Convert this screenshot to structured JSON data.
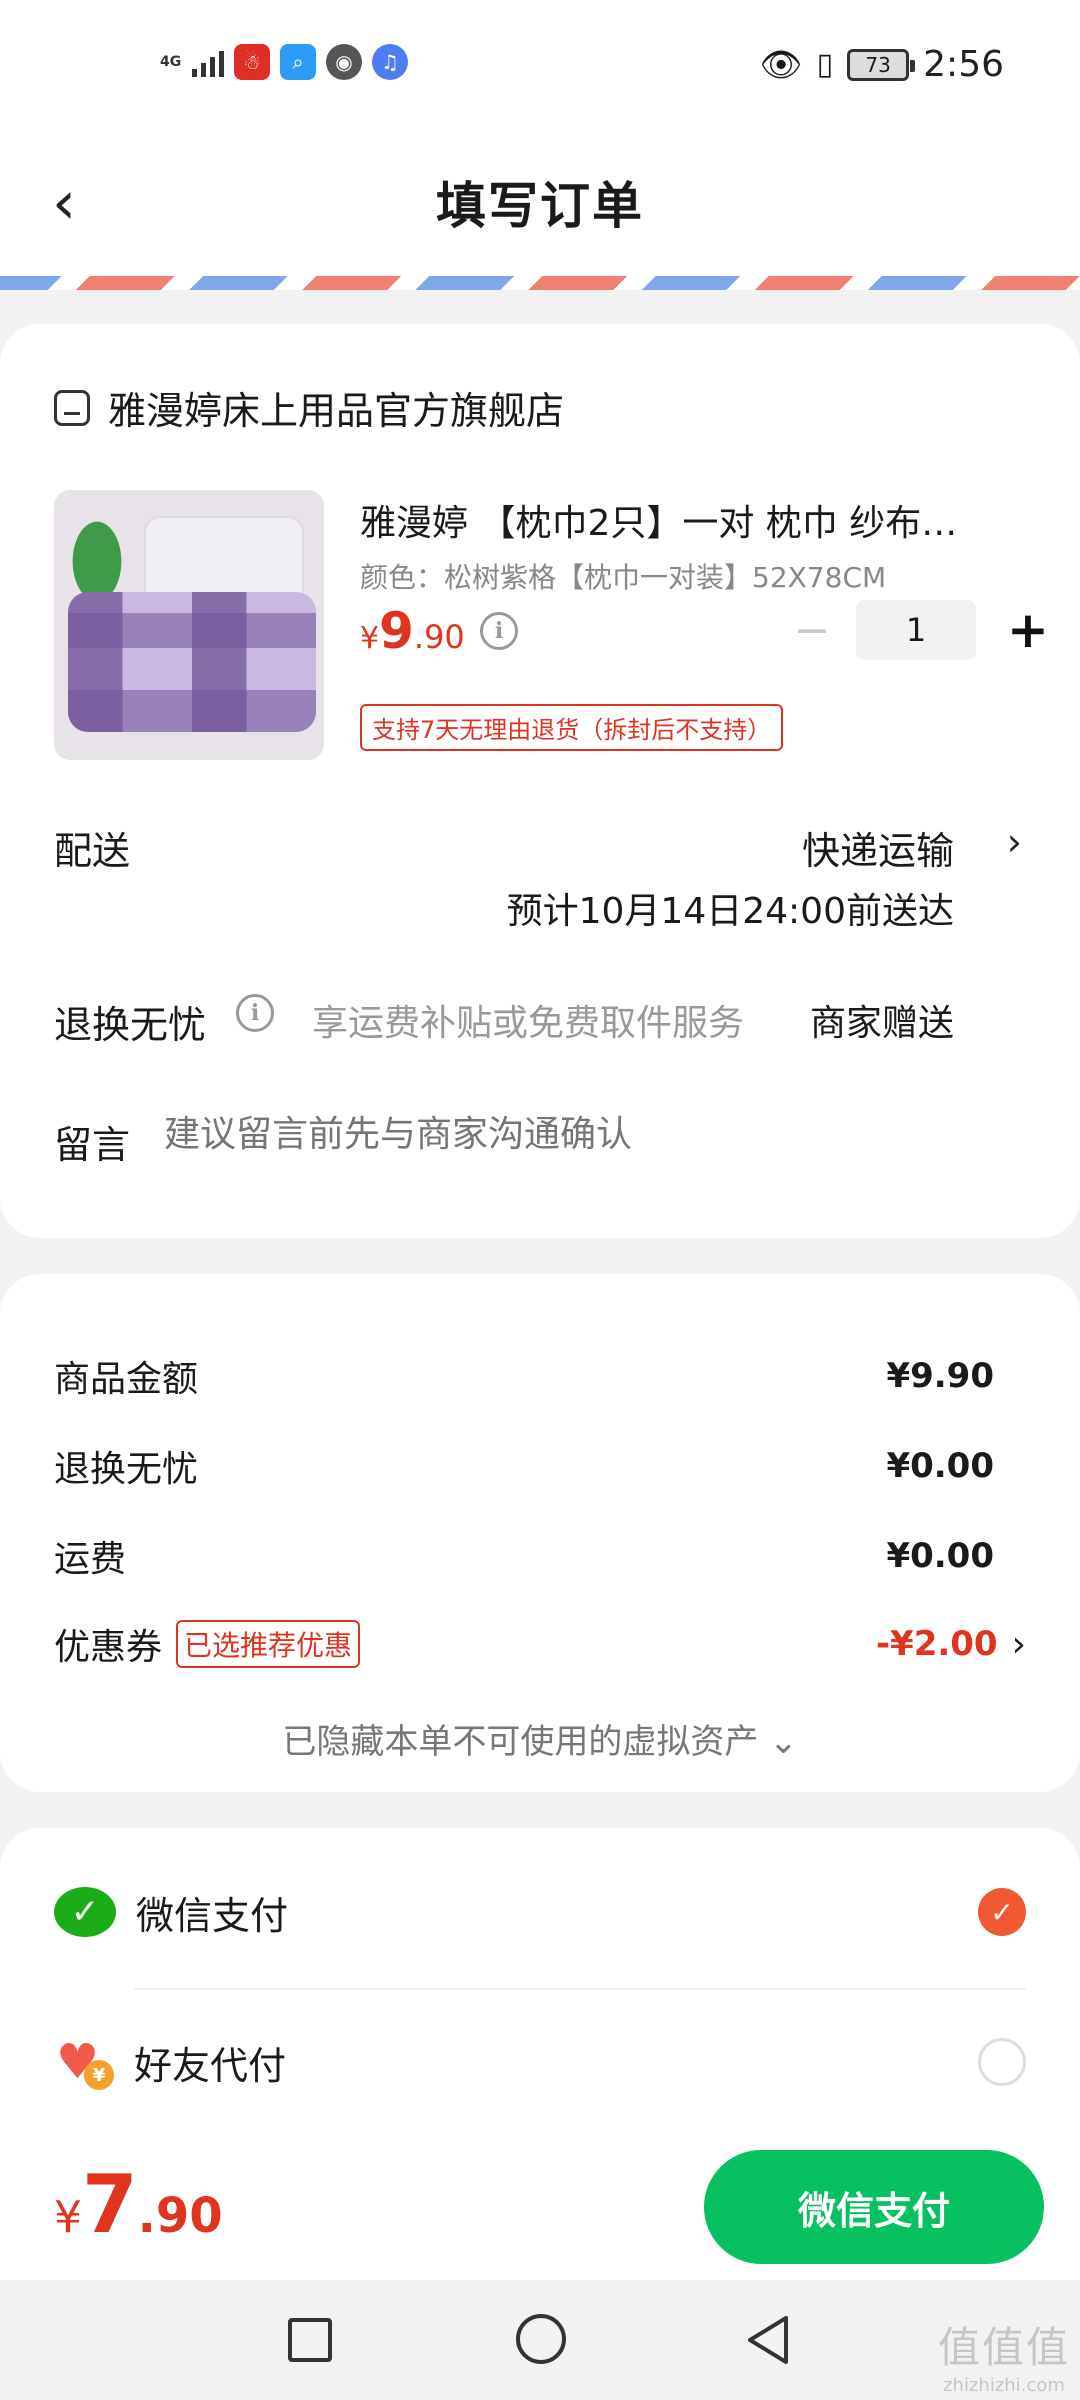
{
  "status_bar": {
    "network": "4G",
    "battery": "73",
    "time": "2:56",
    "app_icons": [
      "pinduoduo-icon",
      "search-app-icon",
      "browser-icon",
      "music-icon"
    ]
  },
  "header": {
    "title": "填写订单"
  },
  "store": {
    "name": "雅漫婷床上用品官方旗舰店"
  },
  "product": {
    "title": "雅漫婷 【枕巾2只】一对  枕巾 纱布…",
    "spec": "颜色：松树紫格【枕巾一对装】52X78CM",
    "price_yen": "¥",
    "price_int": "9",
    "price_dec": ".90",
    "quantity": "1",
    "minus": "−",
    "plus": "+",
    "return_policy": "支持7天无理由退货（拆封后不支持）"
  },
  "shipping": {
    "label": "配送",
    "method": "快递运输",
    "eta": "预计10月14日24:00前送达"
  },
  "return_service": {
    "label": "退换无忧",
    "desc": "享运费补贴或免费取件服务",
    "gift": "商家赠送"
  },
  "note": {
    "label": "留言",
    "placeholder": "建议留言前先与商家沟通确认"
  },
  "summary": {
    "goods_label": "商品金额",
    "goods_value": "¥9.90",
    "return_label": "退换无忧",
    "return_value": "¥0.00",
    "shipping_label": "运费",
    "shipping_value": "¥0.00",
    "coupon_label": "优惠券",
    "coupon_badge": "已选推荐优惠",
    "coupon_value": "-¥2.00",
    "hidden_assets": "已隐藏本单不可使用的虚拟资产 ⌄"
  },
  "payment": {
    "wechat_label": "微信支付",
    "friend_label": "好友代付",
    "selected": "wechat"
  },
  "footer": {
    "total_yen": "¥",
    "total_int": "7",
    "total_dec": ".90",
    "pay_button": "微信支付"
  },
  "watermark": {
    "big": "值值值",
    "small": "zhizhizhi.com"
  },
  "colors": {
    "accent_red": "#e0341f",
    "wechat_green": "#07c160"
  }
}
